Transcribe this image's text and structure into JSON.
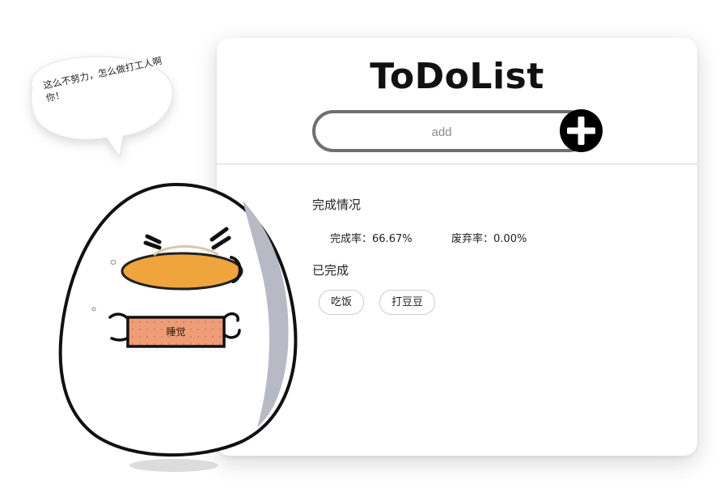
{
  "app": {
    "title": "ToDoList"
  },
  "add_bar": {
    "placeholder": "add"
  },
  "stats": {
    "heading": "完成情况",
    "completion_label": "完成率：",
    "completion_value": "66.67%",
    "abandon_label": "废弃率：",
    "abandon_value": "0.00%"
  },
  "completed": {
    "heading": "已完成",
    "items": [
      {
        "label": "吃饭"
      },
      {
        "label": "打豆豆"
      }
    ]
  },
  "mascot": {
    "speech": "这么不努力，怎么做打工人啊你！",
    "sign": "睡觉"
  },
  "colors": {
    "beak": "#F0A53C",
    "sign": "#EE9D76",
    "accent": "#000000"
  },
  "icons": {
    "add": "plus-circle-icon"
  }
}
